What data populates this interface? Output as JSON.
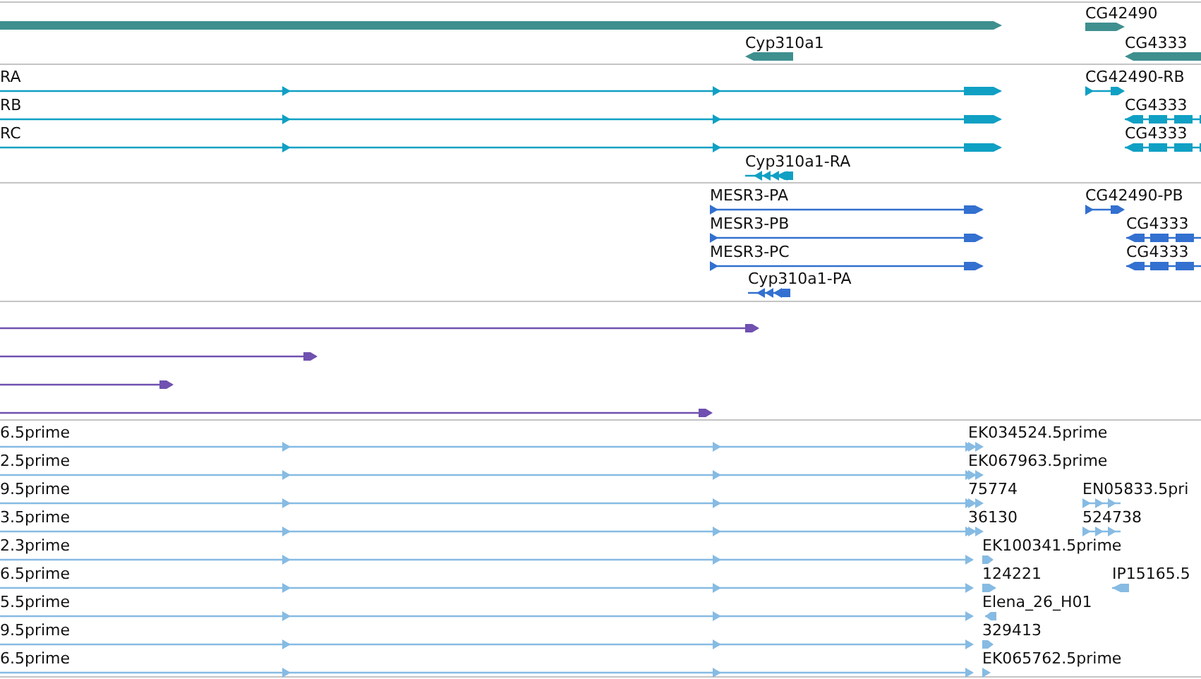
{
  "tracks": [
    {
      "kind": "gene",
      "features": [
        {
          "reverse": false
        },
        {
          "label": "CG42490",
          "reverse": false
        },
        {
          "label": "Cyp310a1",
          "reverse": true
        },
        {
          "label": "CG4333",
          "reverse": true
        }
      ]
    },
    {
      "kind": "mrna",
      "features": [
        {
          "label": "RA",
          "reverse": false
        },
        {
          "label": "CG42490-RB",
          "reverse": false
        },
        {
          "label": "RB",
          "reverse": false
        },
        {
          "label": "CG4333",
          "reverse": true
        },
        {
          "label": "RC",
          "reverse": false
        },
        {
          "label": "CG4333",
          "reverse": true
        },
        {
          "label": "Cyp310a1-RA",
          "reverse": true
        }
      ]
    },
    {
      "kind": "protein",
      "features": [
        {
          "label": "MESR3-PA",
          "reverse": false
        },
        {
          "label": "CG42490-PB",
          "reverse": false
        },
        {
          "label": "MESR3-PB",
          "reverse": false
        },
        {
          "label": "CG4333",
          "reverse": true
        },
        {
          "label": "MESR3-PC",
          "reverse": false
        },
        {
          "label": "CG4333",
          "reverse": true
        },
        {
          "label": "Cyp310a1-PA",
          "reverse": true
        }
      ]
    },
    {
      "kind": "alignment",
      "features": [
        {
          "reverse": false
        },
        {
          "reverse": false
        },
        {
          "reverse": false
        },
        {
          "reverse": false
        }
      ]
    },
    {
      "kind": "est",
      "features": [
        {
          "label": "6.5prime",
          "reverse": false
        },
        {
          "label": "EK034524.5prime",
          "reverse": false
        },
        {
          "label": "2.5prime",
          "reverse": false
        },
        {
          "label": "EK067963.5prime",
          "reverse": false
        },
        {
          "label": "9.5prime",
          "reverse": false
        },
        {
          "label": "75774",
          "reverse": false
        },
        {
          "label": "EN05833.5pri",
          "reverse": false
        },
        {
          "label": "3.5prime",
          "reverse": false
        },
        {
          "label": "36130",
          "reverse": false
        },
        {
          "label": "524738",
          "reverse": false
        },
        {
          "label": "2.3prime",
          "reverse": false
        },
        {
          "label": "EK100341.5prime",
          "reverse": false
        },
        {
          "label": "6.5prime",
          "reverse": false
        },
        {
          "label": "124221",
          "reverse": false
        },
        {
          "label": "IP15165.5",
          "reverse": true
        },
        {
          "label": "5.5prime",
          "reverse": false
        },
        {
          "label": "Elena_26_H01",
          "reverse": true
        },
        {
          "label": "9.5prime",
          "reverse": false
        },
        {
          "label": "329413",
          "reverse": false
        },
        {
          "label": "6.5prime",
          "reverse": false
        },
        {
          "label": "EK065762.5prime",
          "reverse": false
        }
      ]
    }
  ]
}
